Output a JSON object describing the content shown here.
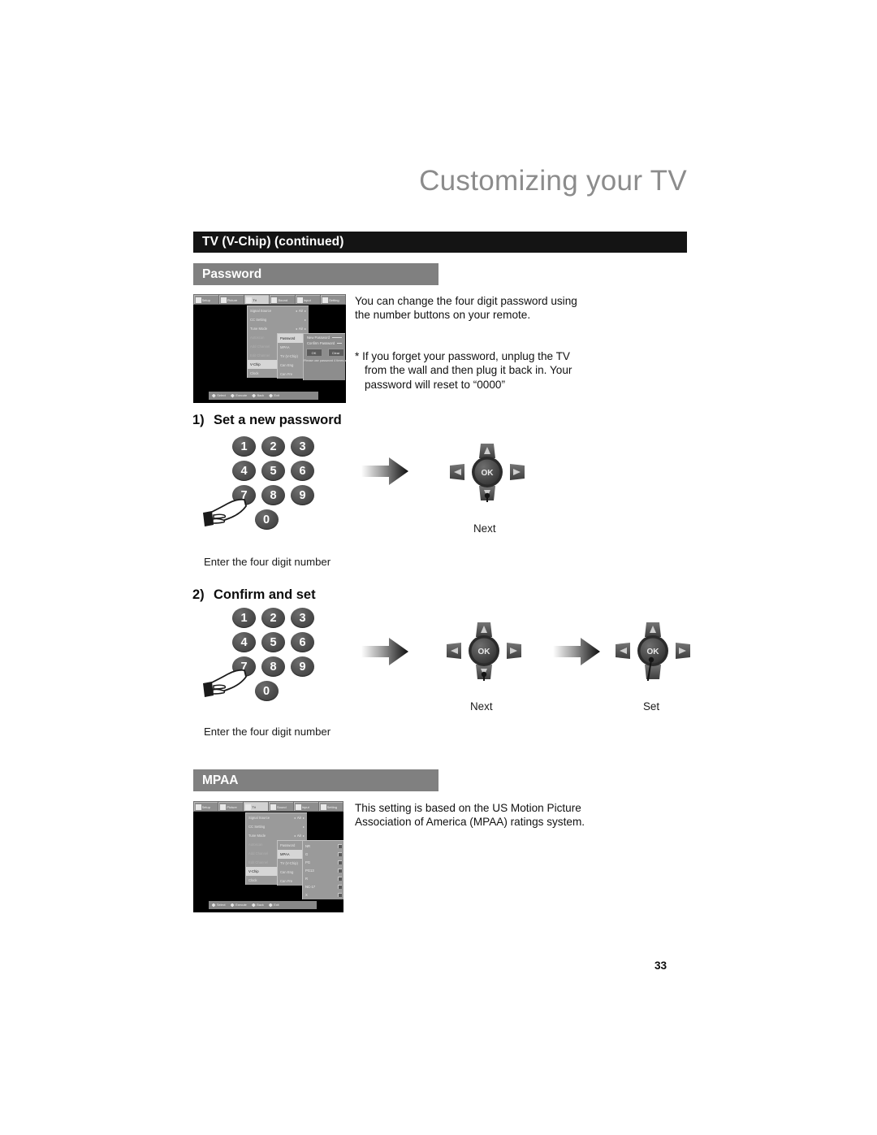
{
  "header": {
    "chapter_title": "Customizing your TV",
    "section_bar": "TV (V-Chip) (continued)"
  },
  "sections": {
    "password": {
      "sub_bar": "Password",
      "paragraph_1": "You can change the four digit password using\nthe number buttons on your remote.",
      "paragraph_2": "* If you forget your password, unplug the TV\n  from the wall and then plug it back in.  Your\n  password will reset to “0000”"
    },
    "mpaa": {
      "sub_bar": "MPAA",
      "paragraph": "This setting is based on the US Motion Picture\nAssociation of America (MPAA) ratings system."
    }
  },
  "steps": [
    {
      "number": "1)",
      "title": "Set a new password",
      "caption": "Enter the four digit number",
      "keypad_rows": [
        [
          "1",
          "2",
          "3"
        ],
        [
          "4",
          "5",
          "6"
        ],
        [
          "7",
          "8",
          "9"
        ],
        [
          "0"
        ]
      ],
      "pressed_key": "7",
      "dpad_actions": [
        {
          "label": "Next",
          "center": "OK"
        }
      ]
    },
    {
      "number": "2)",
      "title": "Confirm and set",
      "caption": "Enter the four digit number",
      "keypad_rows": [
        [
          "1",
          "2",
          "3"
        ],
        [
          "4",
          "5",
          "6"
        ],
        [
          "7",
          "8",
          "9"
        ],
        [
          "0"
        ]
      ],
      "pressed_key": "7",
      "dpad_actions": [
        {
          "label": "Next",
          "center": "OK"
        },
        {
          "label": "Set",
          "center": "OK"
        }
      ]
    }
  ],
  "tv_screens": {
    "password_screen": {
      "menubar": [
        {
          "label": "Setup",
          "icon": "setup-icon",
          "active": false
        },
        {
          "label": "Picture",
          "icon": "picture-icon",
          "active": false
        },
        {
          "label": "TV",
          "icon": "tv-icon",
          "active": true
        },
        {
          "label": "Sound",
          "icon": "sound-icon",
          "active": false
        },
        {
          "label": "Input",
          "icon": "input-icon",
          "active": false
        },
        {
          "label": "Setting",
          "icon": "info-icon",
          "active": false
        }
      ],
      "menu_items": [
        {
          "name": "Signal Source",
          "value": "Air",
          "selected": false
        },
        {
          "name": "CC Setting",
          "value": "",
          "selected": false
        },
        {
          "name": "Tune Mode",
          "value": "Air",
          "selected": false
        },
        {
          "name": "Autoscan",
          "value": "",
          "selected": false
        },
        {
          "name": "Add Channel",
          "value": "",
          "selected": false
        },
        {
          "name": "Edit Channel",
          "value": "",
          "selected": false
        },
        {
          "name": "V-Chip",
          "value": "",
          "selected": true
        },
        {
          "name": "Clock",
          "value": "",
          "selected": false
        }
      ],
      "submenu_items": [
        {
          "name": "Password",
          "selected": true
        },
        {
          "name": "MPAA",
          "selected": false
        },
        {
          "name": "TV (V-Chip)",
          "selected": false
        },
        {
          "name": "Can Eng",
          "selected": false
        },
        {
          "name": "Can Fre",
          "selected": false
        }
      ],
      "dialog": {
        "field_1": "New Password",
        "field_2": "Confirm Password",
        "button_ok": "OK",
        "button_clear": "Clear",
        "note": "Please use password 4 times set"
      },
      "footbar": [
        {
          "label": "Select",
          "icon": "dpad-icon"
        },
        {
          "label": "Execute",
          "icon": "ok-icon"
        },
        {
          "label": "Back",
          "icon": "back-icon"
        },
        {
          "label": "Exit",
          "icon": "exit-icon"
        }
      ]
    },
    "mpaa_screen": {
      "menubar": [
        {
          "label": "Setup",
          "icon": "setup-icon",
          "active": false
        },
        {
          "label": "Picture",
          "icon": "picture-icon",
          "active": false
        },
        {
          "label": "TV",
          "icon": "tv-icon",
          "active": true
        },
        {
          "label": "Sound",
          "icon": "sound-icon",
          "active": false
        },
        {
          "label": "Input",
          "icon": "input-icon",
          "active": false
        },
        {
          "label": "Setting",
          "icon": "info-icon",
          "active": false
        }
      ],
      "menu_items": [
        {
          "name": "Signal Source",
          "value": "Air",
          "selected": false
        },
        {
          "name": "CC Setting",
          "value": "",
          "selected": false
        },
        {
          "name": "Tune Mode",
          "value": "Air",
          "selected": false
        },
        {
          "name": "Autoscan",
          "value": "",
          "selected": false
        },
        {
          "name": "Add Channel",
          "value": "",
          "selected": false
        },
        {
          "name": "Edit Channel",
          "value": "",
          "selected": false
        },
        {
          "name": "V-Chip",
          "value": "",
          "selected": true
        },
        {
          "name": "Clock",
          "value": "",
          "selected": false
        }
      ],
      "submenu_items": [
        {
          "name": "Password",
          "selected": false
        },
        {
          "name": "MPAA",
          "selected": true
        },
        {
          "name": "TV (V-Chip)",
          "selected": false
        },
        {
          "name": "Can Eng",
          "selected": false
        },
        {
          "name": "Can Fre",
          "selected": false
        }
      ],
      "ratings": [
        {
          "label": "NR",
          "checked": true
        },
        {
          "label": "G",
          "checked": true
        },
        {
          "label": "PG",
          "checked": true
        },
        {
          "label": "PG13",
          "checked": true
        },
        {
          "label": "R",
          "checked": true
        },
        {
          "label": "NC-17",
          "checked": true
        },
        {
          "label": "X",
          "checked": true
        }
      ],
      "footbar": [
        {
          "label": "Select",
          "icon": "dpad-icon"
        },
        {
          "label": "Execute",
          "icon": "ok-icon"
        },
        {
          "label": "Back",
          "icon": "back-icon"
        },
        {
          "label": "Exit",
          "icon": "exit-icon"
        }
      ]
    }
  },
  "footer": {
    "page_number": "33"
  },
  "colors": {
    "section_bar_bg": "#141414",
    "sub_bar_bg": "#808080",
    "chapter_title": "#8c8c8c",
    "key_fill": "#4e4e4e",
    "page_bg": "#ffffff"
  }
}
